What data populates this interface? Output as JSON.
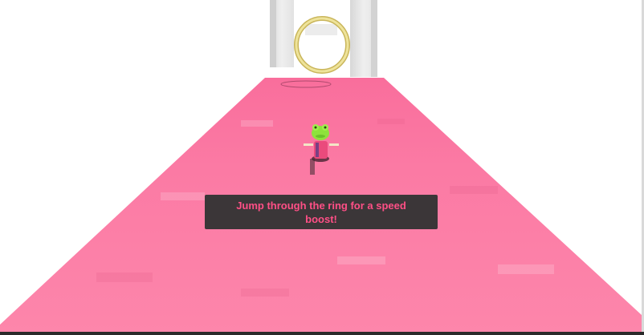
{
  "tutorial": {
    "message": "Jump through the ring for a speed boost!"
  },
  "colors": {
    "track": "#fd82a8",
    "track_shadow": "#f46e96",
    "ring": "#e9dc8c",
    "pillar": "#e5e5e5",
    "tip_background": "#333333",
    "tip_text": "#ff4f86",
    "player_head": "#8ee23c",
    "player_body": "#ea4a7c"
  },
  "icons": {
    "ring": "boost-ring-icon",
    "player": "frog-character-icon"
  }
}
